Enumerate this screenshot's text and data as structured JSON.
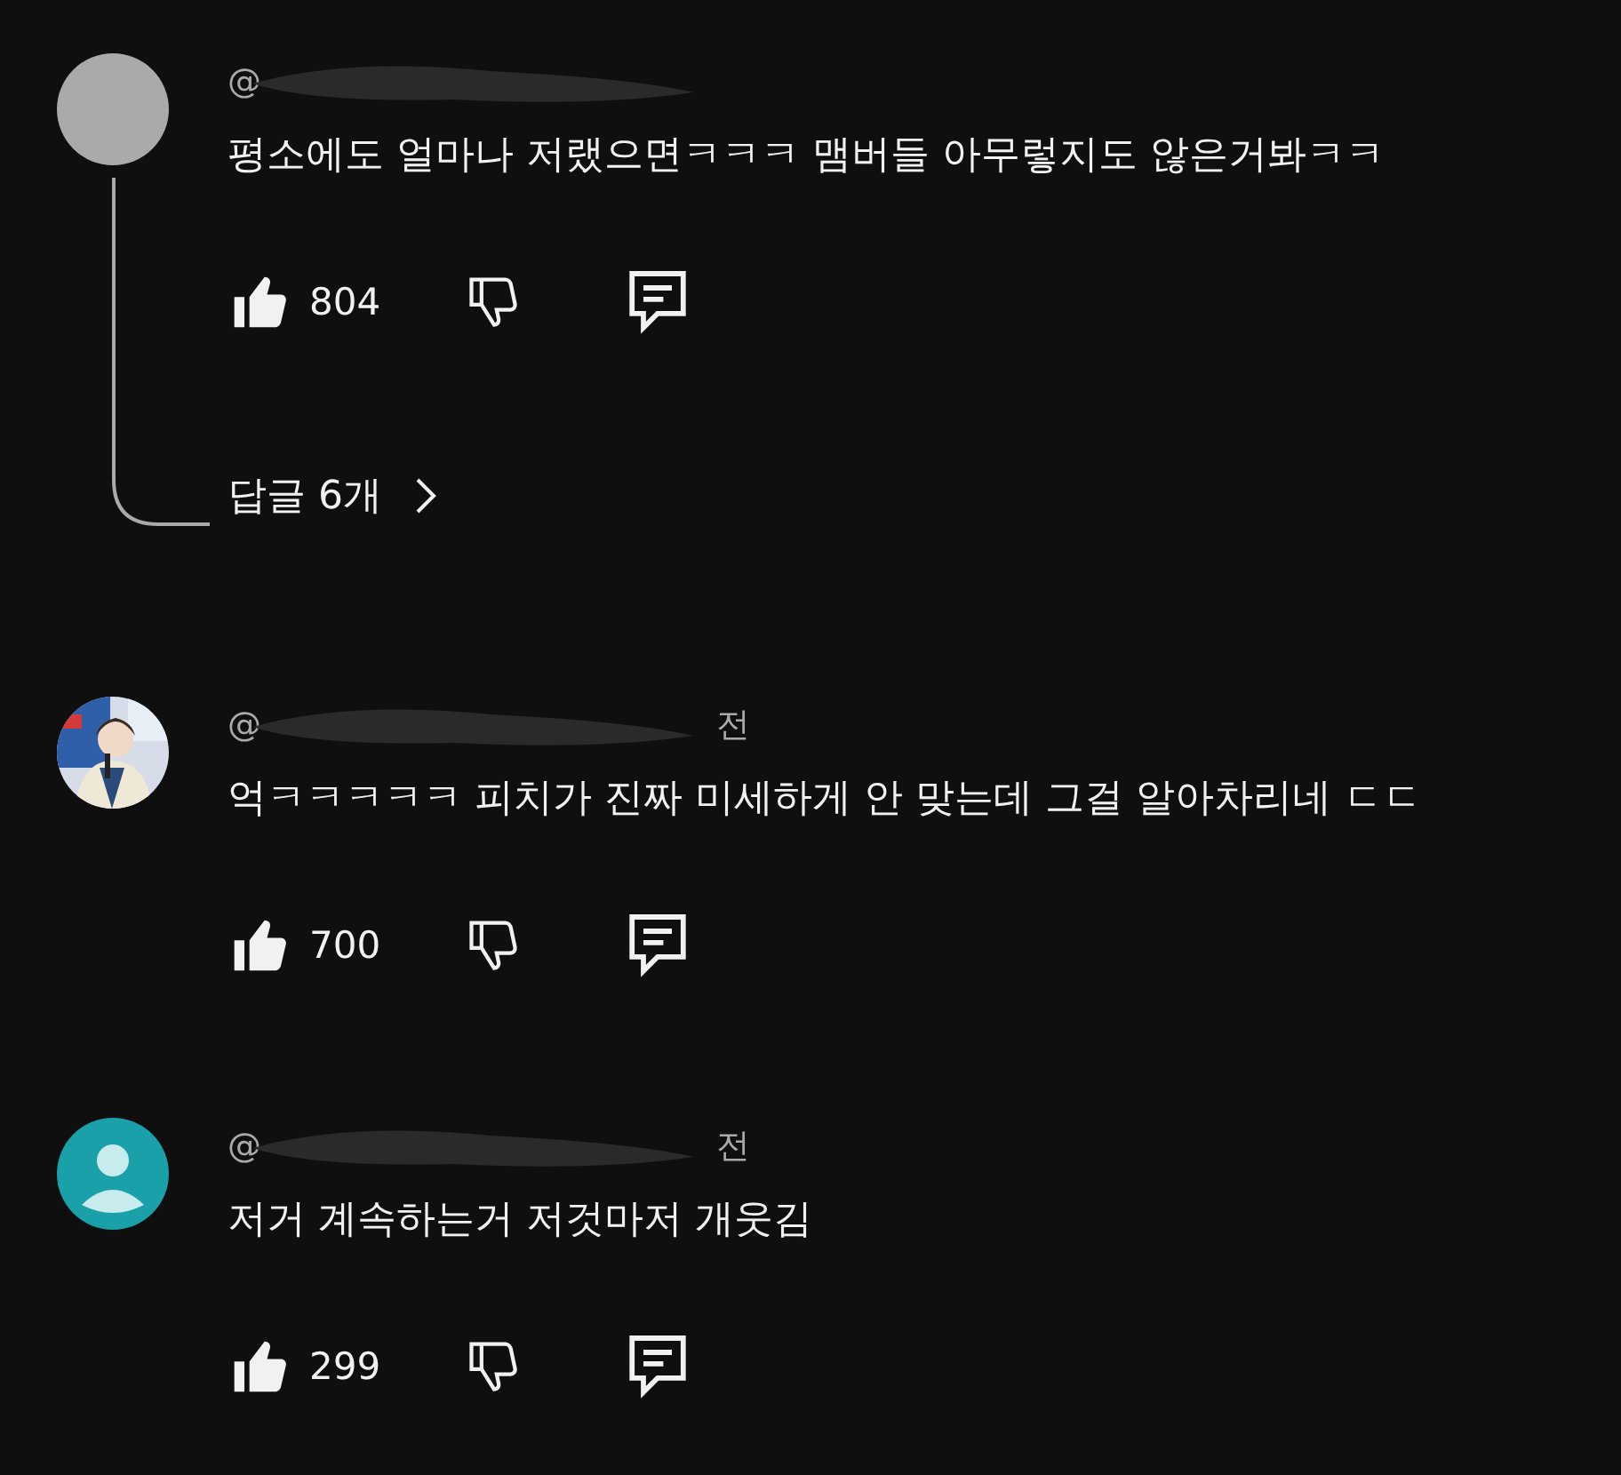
{
  "comments": [
    {
      "kind": "grey",
      "author": "@",
      "text": "평소에도 얼마나 저랬으면ㅋㅋㅋ 맴버들 아무렇지도 않은거봐ㅋㅋ",
      "likes": "804",
      "replies": "답글 6개"
    },
    {
      "kind": "picture",
      "author": "@",
      "time": "전",
      "text": "억ㅋㅋㅋㅋㅋ 피치가 진짜 미세하게 안 맞는데 그걸 알아차리네 ㄷㄷ",
      "likes": "700"
    },
    {
      "kind": "default",
      "author": "@",
      "time": "전",
      "text": "저거 계속하는거 저것마저 개웃김",
      "likes": "299"
    }
  ]
}
